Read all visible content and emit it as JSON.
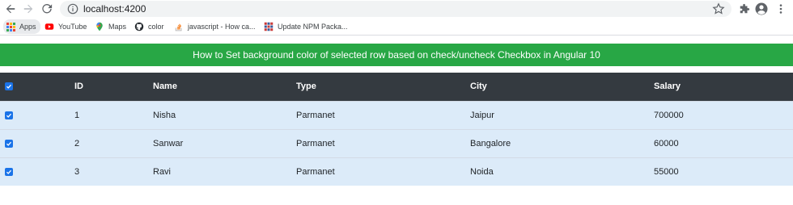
{
  "browser": {
    "url": "localhost:4200",
    "bookmarks": [
      {
        "label": "Apps",
        "icon": "apps-grid-icon"
      },
      {
        "label": "YouTube",
        "icon": "youtube-icon"
      },
      {
        "label": "Maps",
        "icon": "maps-pin-icon"
      },
      {
        "label": "color",
        "icon": "github-icon"
      },
      {
        "label": "javascript - How ca...",
        "icon": "stackoverflow-icon"
      },
      {
        "label": "Update NPM Packa...",
        "icon": "npm-grid-icon"
      }
    ]
  },
  "page": {
    "banner_title": "How to Set background color of selected row based on check/uncheck Checkbox in Angular 10",
    "colors": {
      "banner": "#28a745",
      "header": "#343a40",
      "selected_row": "#dcebf9",
      "checkbox": "#1a73e8"
    }
  },
  "table": {
    "select_all_checked": true,
    "headers": {
      "id": "ID",
      "name": "Name",
      "type": "Type",
      "city": "City",
      "salary": "Salary"
    },
    "rows": [
      {
        "checked": true,
        "id": "1",
        "name": "Nisha",
        "type": "Parmanet",
        "city": "Jaipur",
        "salary": "700000"
      },
      {
        "checked": true,
        "id": "2",
        "name": "Sanwar",
        "type": "Parmanet",
        "city": "Bangalore",
        "salary": "60000"
      },
      {
        "checked": true,
        "id": "3",
        "name": "Ravi",
        "type": "Parmanet",
        "city": "Noida",
        "salary": "55000"
      }
    ]
  }
}
